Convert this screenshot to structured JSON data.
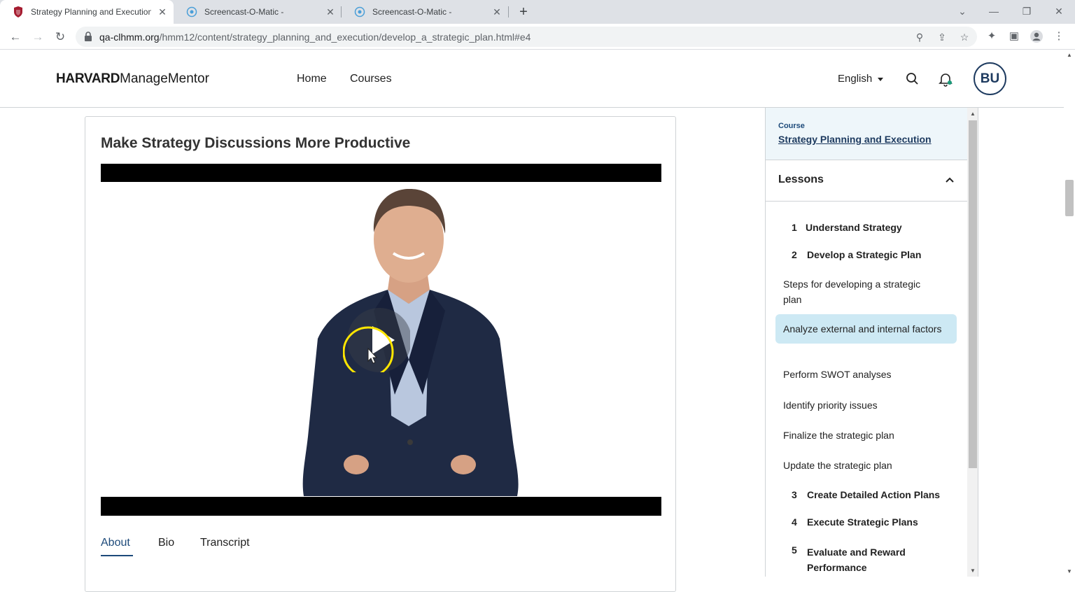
{
  "browser": {
    "tabs": [
      {
        "title": "Strategy Planning and Execution",
        "active": true
      },
      {
        "title": "Screencast-O-Matic -",
        "active": false
      },
      {
        "title": "Screencast-O-Matic -",
        "active": false
      }
    ],
    "url_host": "qa-clhmm.org",
    "url_path": "/hmm12/content/strategy_planning_and_execution/develop_a_strategic_plan.html#e4"
  },
  "header": {
    "logo_bold": "HARVARD",
    "logo_light": "ManageMentor",
    "nav": [
      "Home",
      "Courses"
    ],
    "language": "English",
    "avatar_initials": "BU"
  },
  "main": {
    "title": "Make Strategy Discussions More Productive",
    "tabs": [
      "About",
      "Bio",
      "Transcript"
    ],
    "active_tab": "About"
  },
  "panel": {
    "course_kicker": "Course",
    "course_title": "Strategy Planning and Execution",
    "lessons_title": "Lessons",
    "lessons": [
      {
        "num": "1",
        "label": "Understand Strategy"
      },
      {
        "num": "2",
        "label": "Develop a Strategic Plan"
      },
      {
        "num": "3",
        "label": "Create Detailed Action Plans"
      },
      {
        "num": "4",
        "label": "Execute Strategic Plans"
      },
      {
        "num": "5",
        "label": "Evaluate and Reward Performance"
      }
    ],
    "subtopics": [
      "Steps for developing a strategic plan",
      "Analyze external and internal factors",
      "Perform SWOT analyses",
      "Identify priority issues",
      "Finalize the strategic plan",
      "Update the strategic plan"
    ],
    "active_subtopic": "Analyze external and internal factors"
  }
}
